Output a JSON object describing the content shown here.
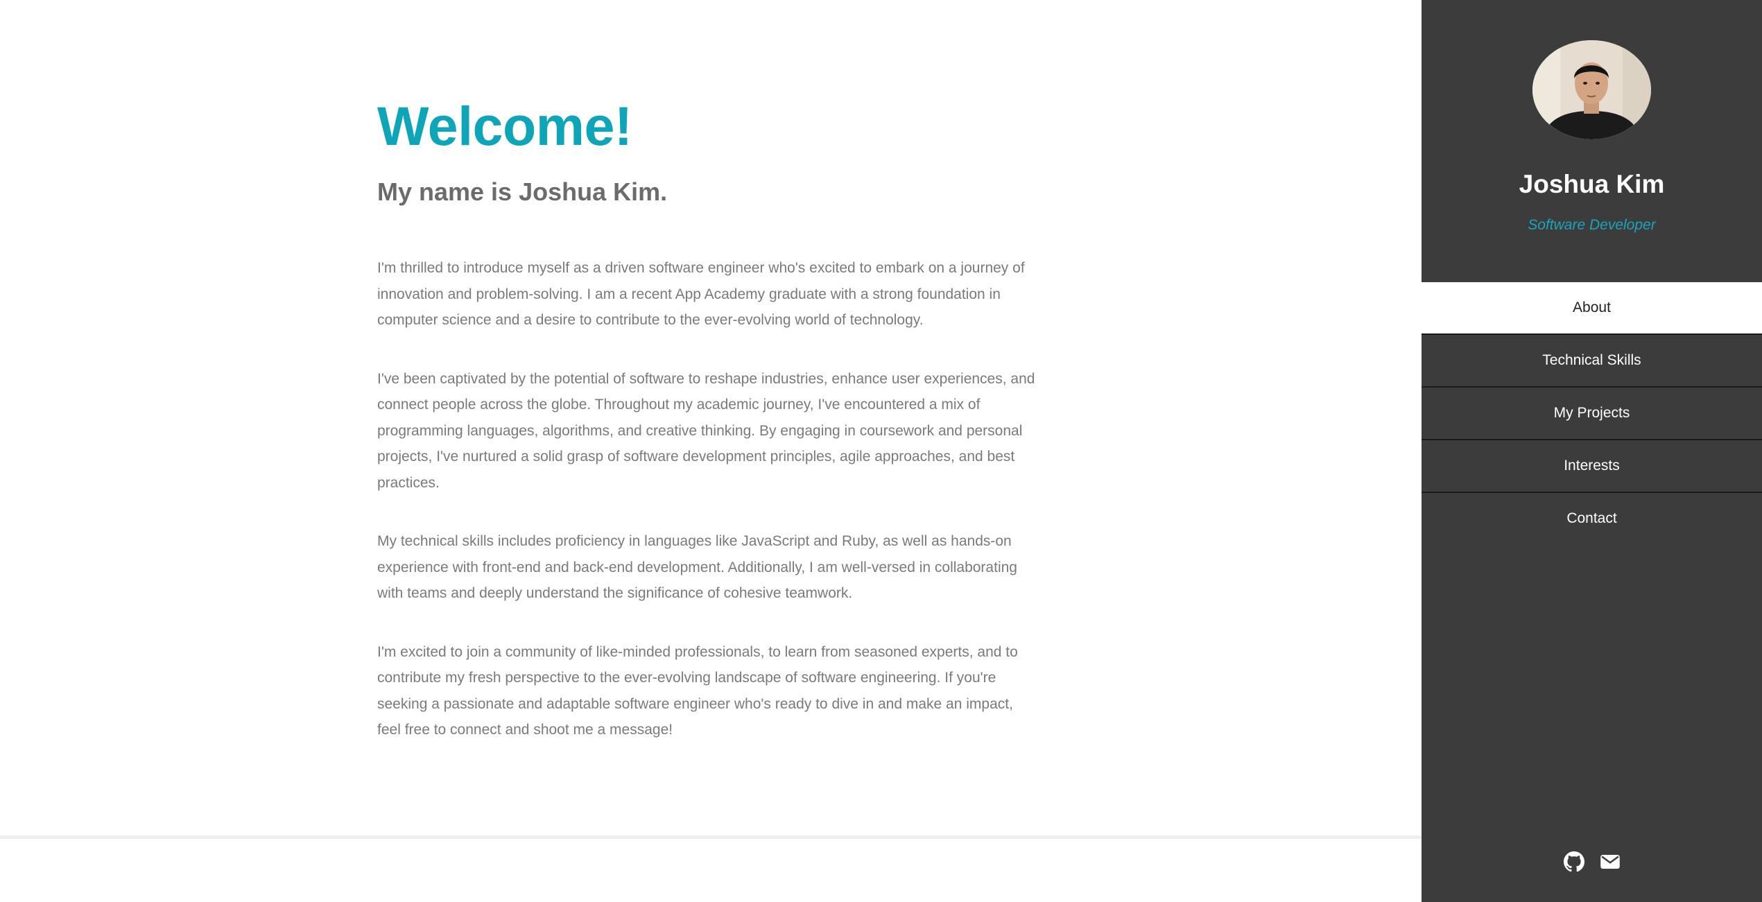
{
  "main": {
    "heading": "Welcome!",
    "subheading": "My name is Joshua Kim.",
    "paragraphs": [
      "I'm thrilled to introduce myself as a driven software engineer who's excited to embark on a journey of innovation and problem-solving. I am a recent App Academy graduate with a strong foundation in computer science and a desire to contribute to the ever-evolving world of technology.",
      "I've been captivated by the potential of software to reshape industries, enhance user experiences, and connect people across the globe. Throughout my academic journey, I've encountered a mix of programming languages, algorithms, and creative thinking. By engaging in coursework and personal projects, I've nurtured a solid grasp of software development principles, agile approaches, and best practices.",
      "My technical skills includes proficiency in languages like JavaScript and Ruby, as well as hands-on experience with front-end and back-end development. Additionally, I am well-versed in collaborating with teams and deeply understand the significance of cohesive teamwork.",
      "I'm excited to join a community of like-minded professionals, to learn from seasoned experts, and to contribute my fresh perspective to the ever-evolving landscape of software engineering. If you're seeking a passionate and adaptable software engineer who's ready to dive in and make an impact, feel free to connect and shoot me a message!"
    ]
  },
  "sidebar": {
    "name": "Joshua Kim",
    "title": "Software Developer",
    "nav": [
      {
        "label": "About",
        "active": true
      },
      {
        "label": "Technical Skills",
        "active": false
      },
      {
        "label": "My Projects",
        "active": false
      },
      {
        "label": "Interests",
        "active": false
      },
      {
        "label": "Contact",
        "active": false
      }
    ],
    "social": [
      {
        "icon": "github-icon"
      },
      {
        "icon": "envelope-icon"
      }
    ]
  },
  "colors": {
    "accent": "#0ea5b9",
    "sidebar_bg": "#3c3c3c",
    "text_muted": "#7a7a7a"
  }
}
